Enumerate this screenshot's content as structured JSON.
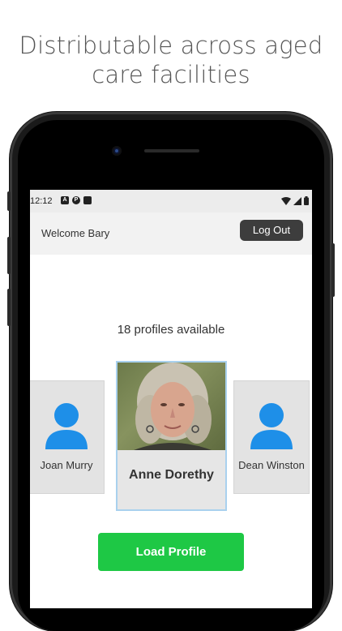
{
  "headline": {
    "line1": "Distributable across aged",
    "line2": "care facilities"
  },
  "status_bar": {
    "time": "12:12",
    "icons": [
      "notification-a-icon",
      "notification-p-icon",
      "sd-card-icon"
    ],
    "right_icons": [
      "wifi-icon",
      "signal-icon",
      "battery-icon"
    ]
  },
  "app_bar": {
    "welcome_text": "Welcome Bary",
    "logout_label": "Log Out"
  },
  "profiles": {
    "available_text": "18 profiles available",
    "cards": [
      {
        "name": "Joan Murry",
        "has_photo": false
      },
      {
        "name": "Anne Dorethy",
        "has_photo": true,
        "selected": true
      },
      {
        "name": "Dean Winston",
        "has_photo": false
      }
    ]
  },
  "actions": {
    "load_profile_label": "Load Profile"
  },
  "colors": {
    "accent_green": "#1ec845",
    "avatar_blue": "#1e8fe8",
    "logout_bg": "#3d3d3d",
    "selected_border": "#a9d1ee"
  }
}
